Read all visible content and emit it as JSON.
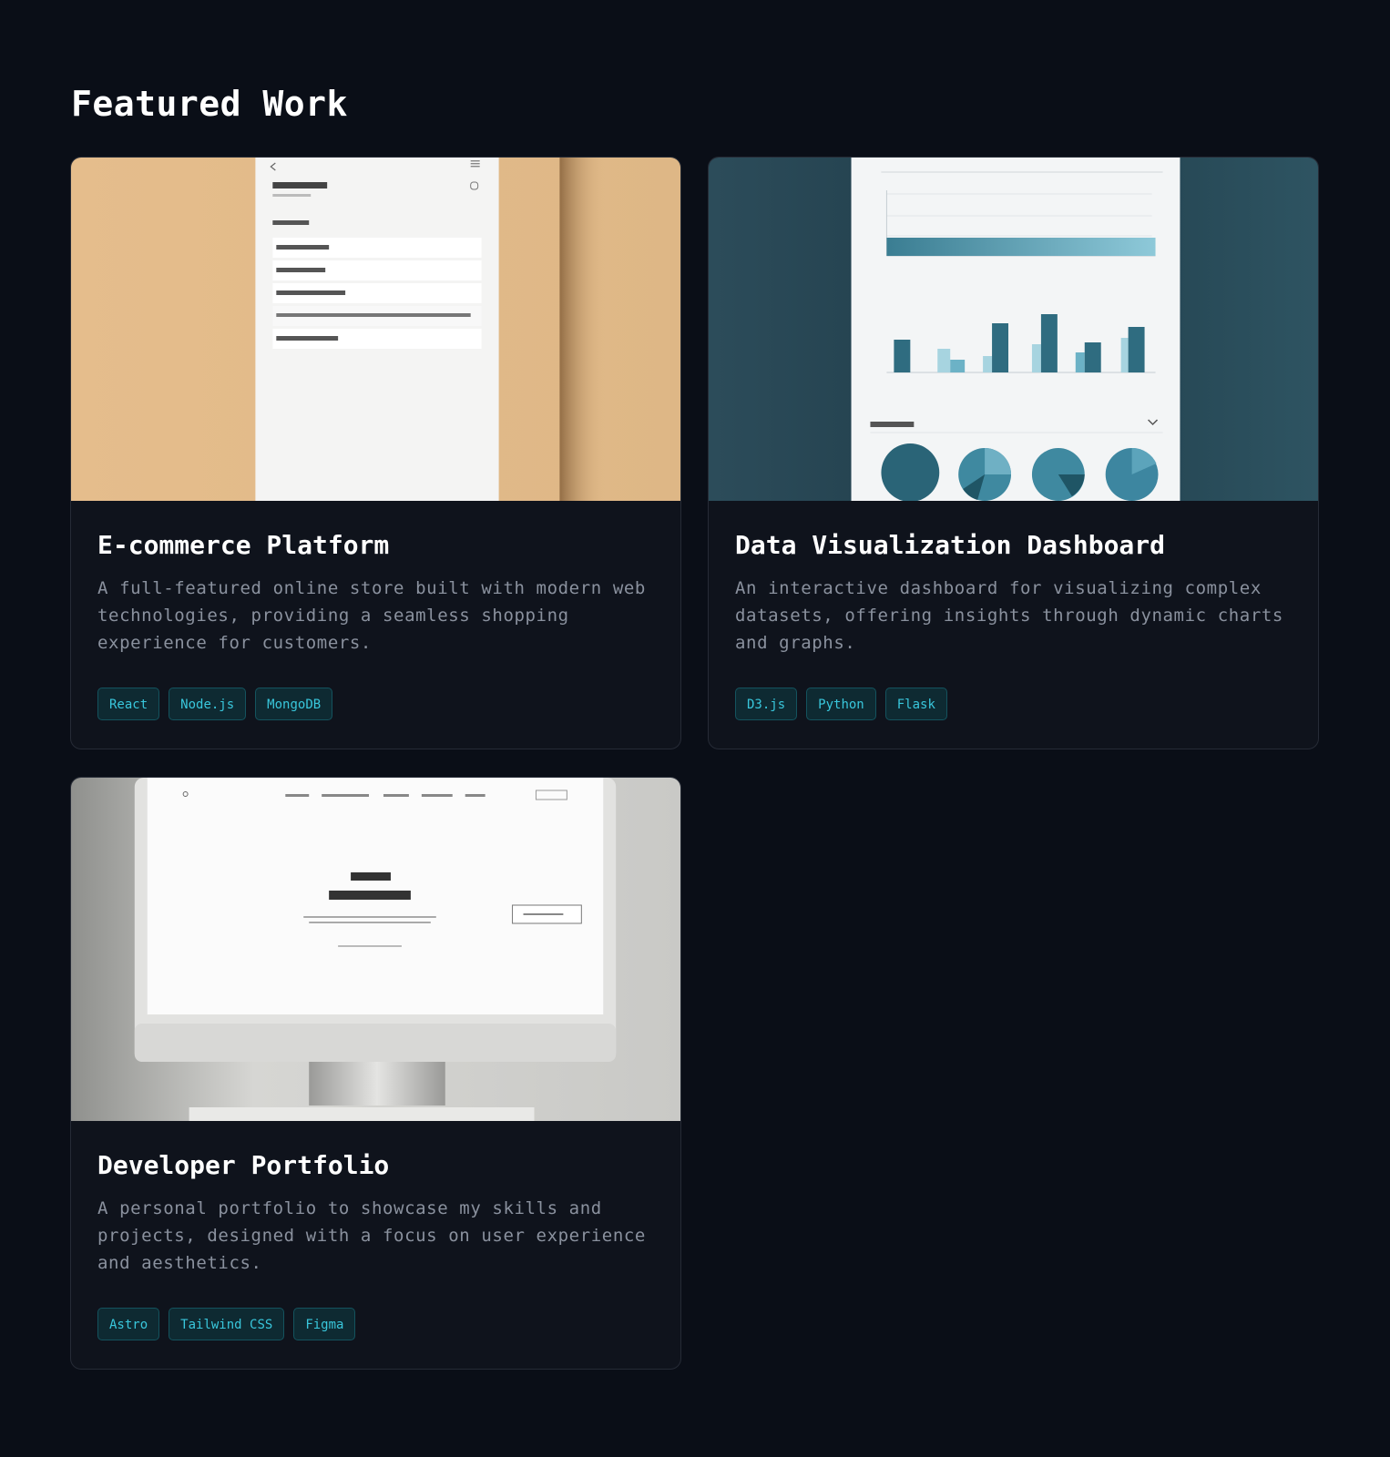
{
  "section": {
    "title": "Featured Work"
  },
  "projects": [
    {
      "title": "E-commerce Platform",
      "description": "A full-featured online store built with modern web technologies, providing a seamless shopping experience for customers.",
      "tags": [
        "React",
        "Node.js",
        "MongoDB"
      ],
      "thumbnail": "ecommerce-app-screenshot"
    },
    {
      "title": "Data Visualization Dashboard",
      "description": "An interactive dashboard for visualizing complex datasets, offering insights through dynamic charts and graphs.",
      "tags": [
        "D3.js",
        "Python",
        "Flask"
      ],
      "thumbnail": "dashboard-screenshot"
    },
    {
      "title": "Developer Portfolio",
      "description": "A personal portfolio to showcase my skills and projects, designed with a focus on user experience and aesthetics.",
      "tags": [
        "Astro",
        "Tailwind CSS",
        "Figma"
      ],
      "thumbnail": "portfolio-monitor-screenshot"
    }
  ],
  "colors": {
    "background": "#0a0e17",
    "card": "#0f131c",
    "tag_text": "#39c7dc",
    "tag_bg": "#0e2a32"
  }
}
